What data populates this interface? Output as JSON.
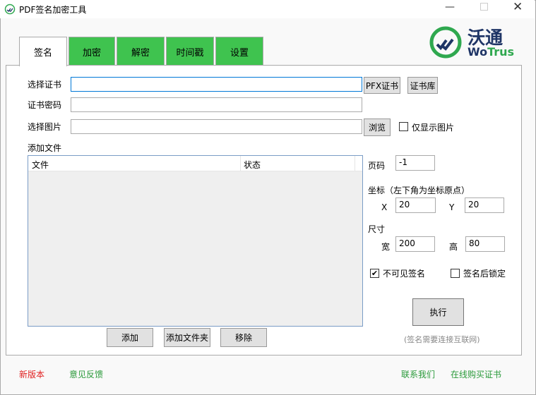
{
  "window": {
    "title": "PDF签名加密工具"
  },
  "logo": {
    "cn": "沃通",
    "en_wo": "Wo",
    "en_trus": "Trus",
    "brand_color": "#2fa84f",
    "text_color": "#1f3566"
  },
  "tabs": [
    {
      "label": "签名"
    },
    {
      "label": "加密"
    },
    {
      "label": "解密"
    },
    {
      "label": "时间戳"
    },
    {
      "label": "设置"
    }
  ],
  "form": {
    "cert_label": "选择证书",
    "cert_value": "",
    "pfx_button": "PFX证书",
    "store_button": "证书库",
    "password_label": "证书密码",
    "password_value": "",
    "image_label": "选择图片",
    "image_value": "",
    "browse_button": "浏览",
    "image_only_label": "仅显示图片",
    "image_only_checked": false,
    "add_files_label": "添加文件"
  },
  "file_table": {
    "columns": [
      "文件",
      "状态"
    ],
    "rows": []
  },
  "file_buttons": {
    "add": "添加",
    "add_folder": "添加文件夹",
    "remove": "移除"
  },
  "settings": {
    "page_label": "页码",
    "page_value": "-1",
    "coord_label": "坐标（左下角为坐标原点）",
    "x_label": "X",
    "x_value": "20",
    "y_label": "Y",
    "y_value": "20",
    "size_label": "尺寸",
    "width_label": "宽",
    "width_value": "200",
    "height_label": "高",
    "height_value": "80",
    "invisible_label": "不可见签名",
    "invisible_checked": true,
    "lock_label": "签名后锁定",
    "lock_checked": false,
    "execute_button": "执行",
    "note": "(签名需要连接互联网)"
  },
  "footer": {
    "new_version": "新版本",
    "feedback": "意见反馈",
    "contact": "联系我们",
    "buy_cert": "在线购买证书"
  }
}
